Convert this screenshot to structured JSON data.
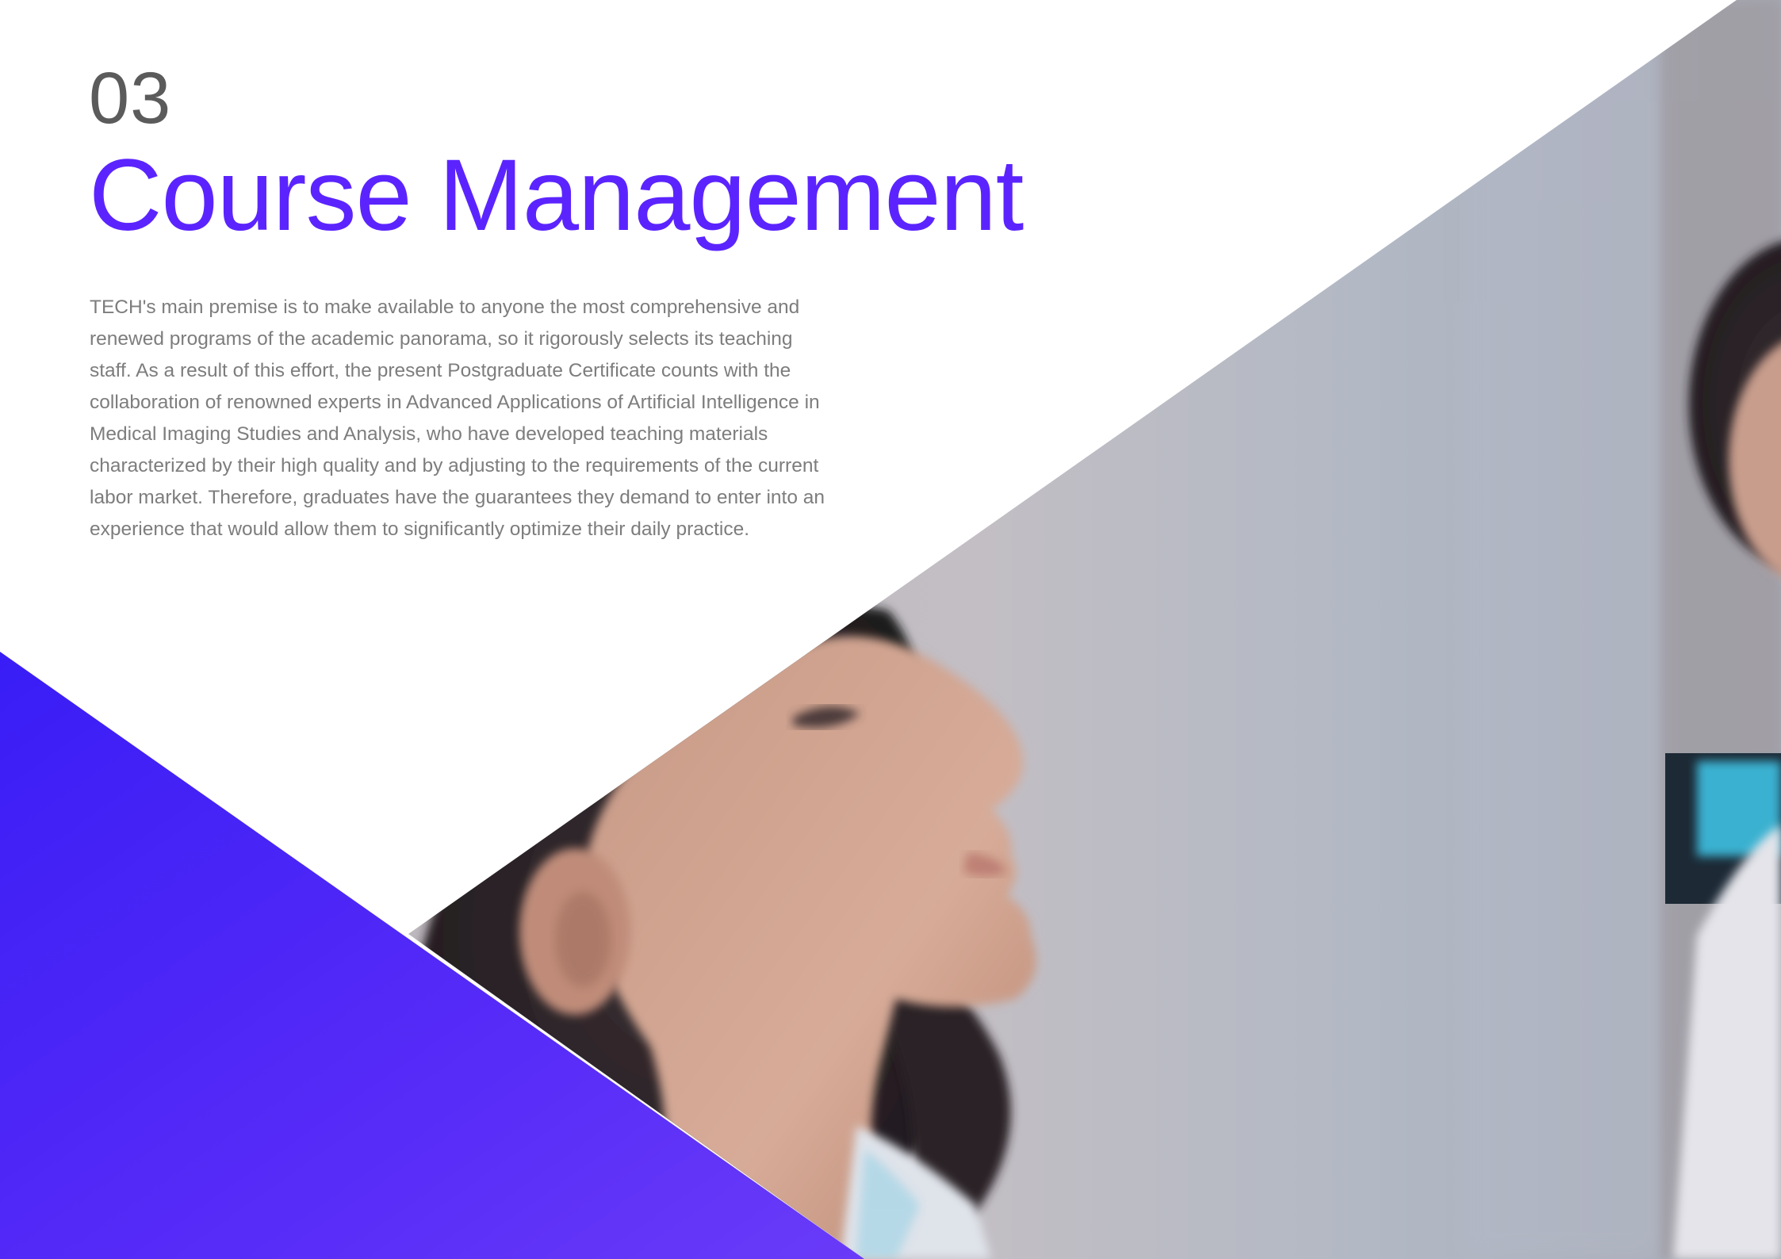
{
  "section": {
    "number": "03",
    "title": "Course Management"
  },
  "body": {
    "paragraph": "TECH's main premise is to make available to anyone the most comprehensive and renewed programs of the academic panorama, so it rigorously selects its teaching staff. As a result of this effort, the present Postgraduate Certificate counts with the collaboration of renowned experts in Advanced Applications of Artificial Intelligence in Medical Imaging Studies and Analysis, who have developed teaching materials characterized by their high quality and by adjusting to the requirements of the current labor market. Therefore, graduates have the guarantees they demand to enter into an experience that would allow them to significantly optimize their daily practice."
  },
  "colors": {
    "accent": "#5b24ff",
    "number": "#5b5b5b",
    "body_text": "#7d7d7d",
    "triangle_start": "#2a0cf5",
    "triangle_end": "#5e2cf8"
  },
  "images": {
    "hero": "woman-looking-up-photo"
  }
}
